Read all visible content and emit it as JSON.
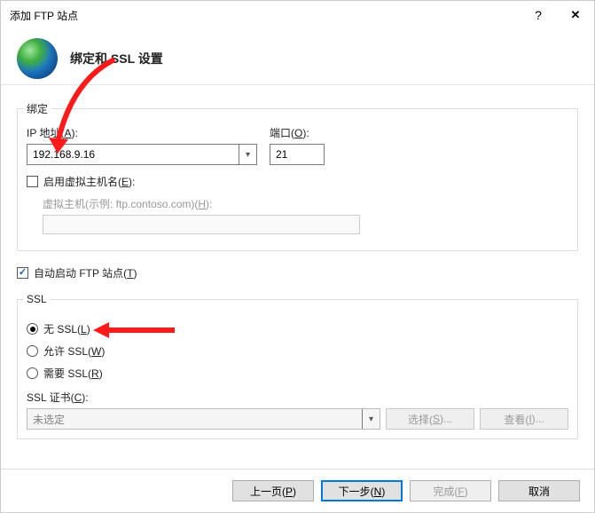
{
  "titlebar": {
    "title": "添加 FTP 站点"
  },
  "header": {
    "title": "绑定和 SSL 设置"
  },
  "binding": {
    "legend": "绑定",
    "ip_label": "IP 地址(A):",
    "ip_value": "192.168.9.16",
    "port_label": "端口(O):",
    "port_value": "21",
    "vhost_label": "启用虚拟主机名(E):",
    "vhost_example_label": "虚拟主机(示例: ftp.contoso.com)(H):"
  },
  "auto_start_label": "自动启动 FTP 站点(T)",
  "ssl": {
    "legend": "SSL",
    "none": "无 SSL(L)",
    "allow": "允许 SSL(W)",
    "require": "需要 SSL(R)",
    "cert_label": "SSL 证书(C):",
    "cert_value": "未选定",
    "select_btn": "选择(S)...",
    "view_btn": "查看(I)..."
  },
  "footer": {
    "prev": "上一页(P)",
    "next": "下一步(N)",
    "finish": "完成(F)",
    "cancel": "取消"
  },
  "icons": {
    "help": "?",
    "close": "✕",
    "chevron_down": "▾"
  }
}
